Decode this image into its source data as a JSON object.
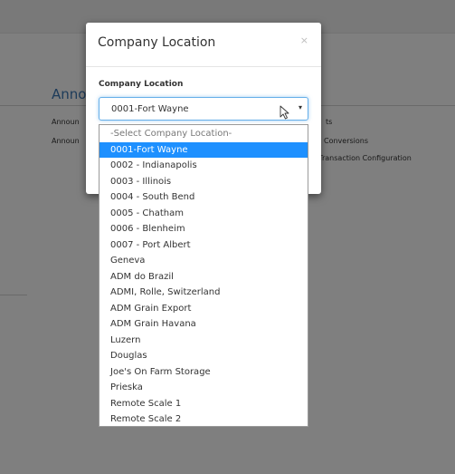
{
  "background": {
    "title": "Anno",
    "links": [
      "Announ",
      "Announ",
      "ts",
      "Conversions",
      "y Transaction Configuration"
    ]
  },
  "modal": {
    "title": "Company Location",
    "close_glyph": "×",
    "field_label": "Company Location",
    "selected_value": "0001-Fort Wayne",
    "arrow_glyph": "▾"
  },
  "dropdown": {
    "options": [
      "-Select Company Location-",
      "0001-Fort Wayne",
      "0002 - Indianapolis",
      "0003 - Illinois",
      "0004 - South Bend",
      "0005 - Chatham",
      "0006 - Blenheim",
      "0007 - Port Albert",
      "Geneva",
      "ADM do Brazil",
      "ADMI, Rolle, Switzerland",
      "ADM Grain Export",
      "ADM Grain Havana",
      "Luzern",
      "Douglas",
      "Joe's On Farm Storage",
      "Prieska",
      "Remote Scale 1",
      "Remote Scale 2"
    ],
    "selected_index": 1
  },
  "colors": {
    "accent": "#1e90ff",
    "focus_border": "#66afe9"
  }
}
